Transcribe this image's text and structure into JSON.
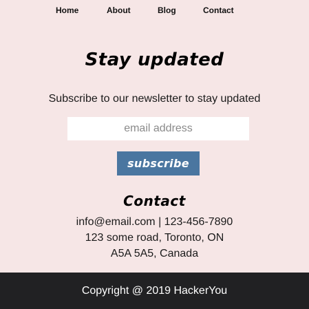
{
  "nav": {
    "items": [
      {
        "label": "Home"
      },
      {
        "label": "About"
      },
      {
        "label": "Blog"
      },
      {
        "label": "Contact"
      }
    ]
  },
  "newsletter": {
    "heading": "Stay updated",
    "subtext": "Subscribe to our newsletter to stay updated",
    "email_placeholder": "email address",
    "subscribe_label": "subscribe"
  },
  "contact": {
    "heading": "Contact",
    "lines": [
      "info@email.com | 123-456-7890",
      "123 some road, Toronto, ON",
      "A5A 5A5, Canada"
    ]
  },
  "footer": {
    "copyright": "Copyright @ 2019 HackerYou"
  },
  "colors": {
    "background": "#f6e6e6",
    "button": "#4a76a0",
    "footer": "#212123"
  }
}
